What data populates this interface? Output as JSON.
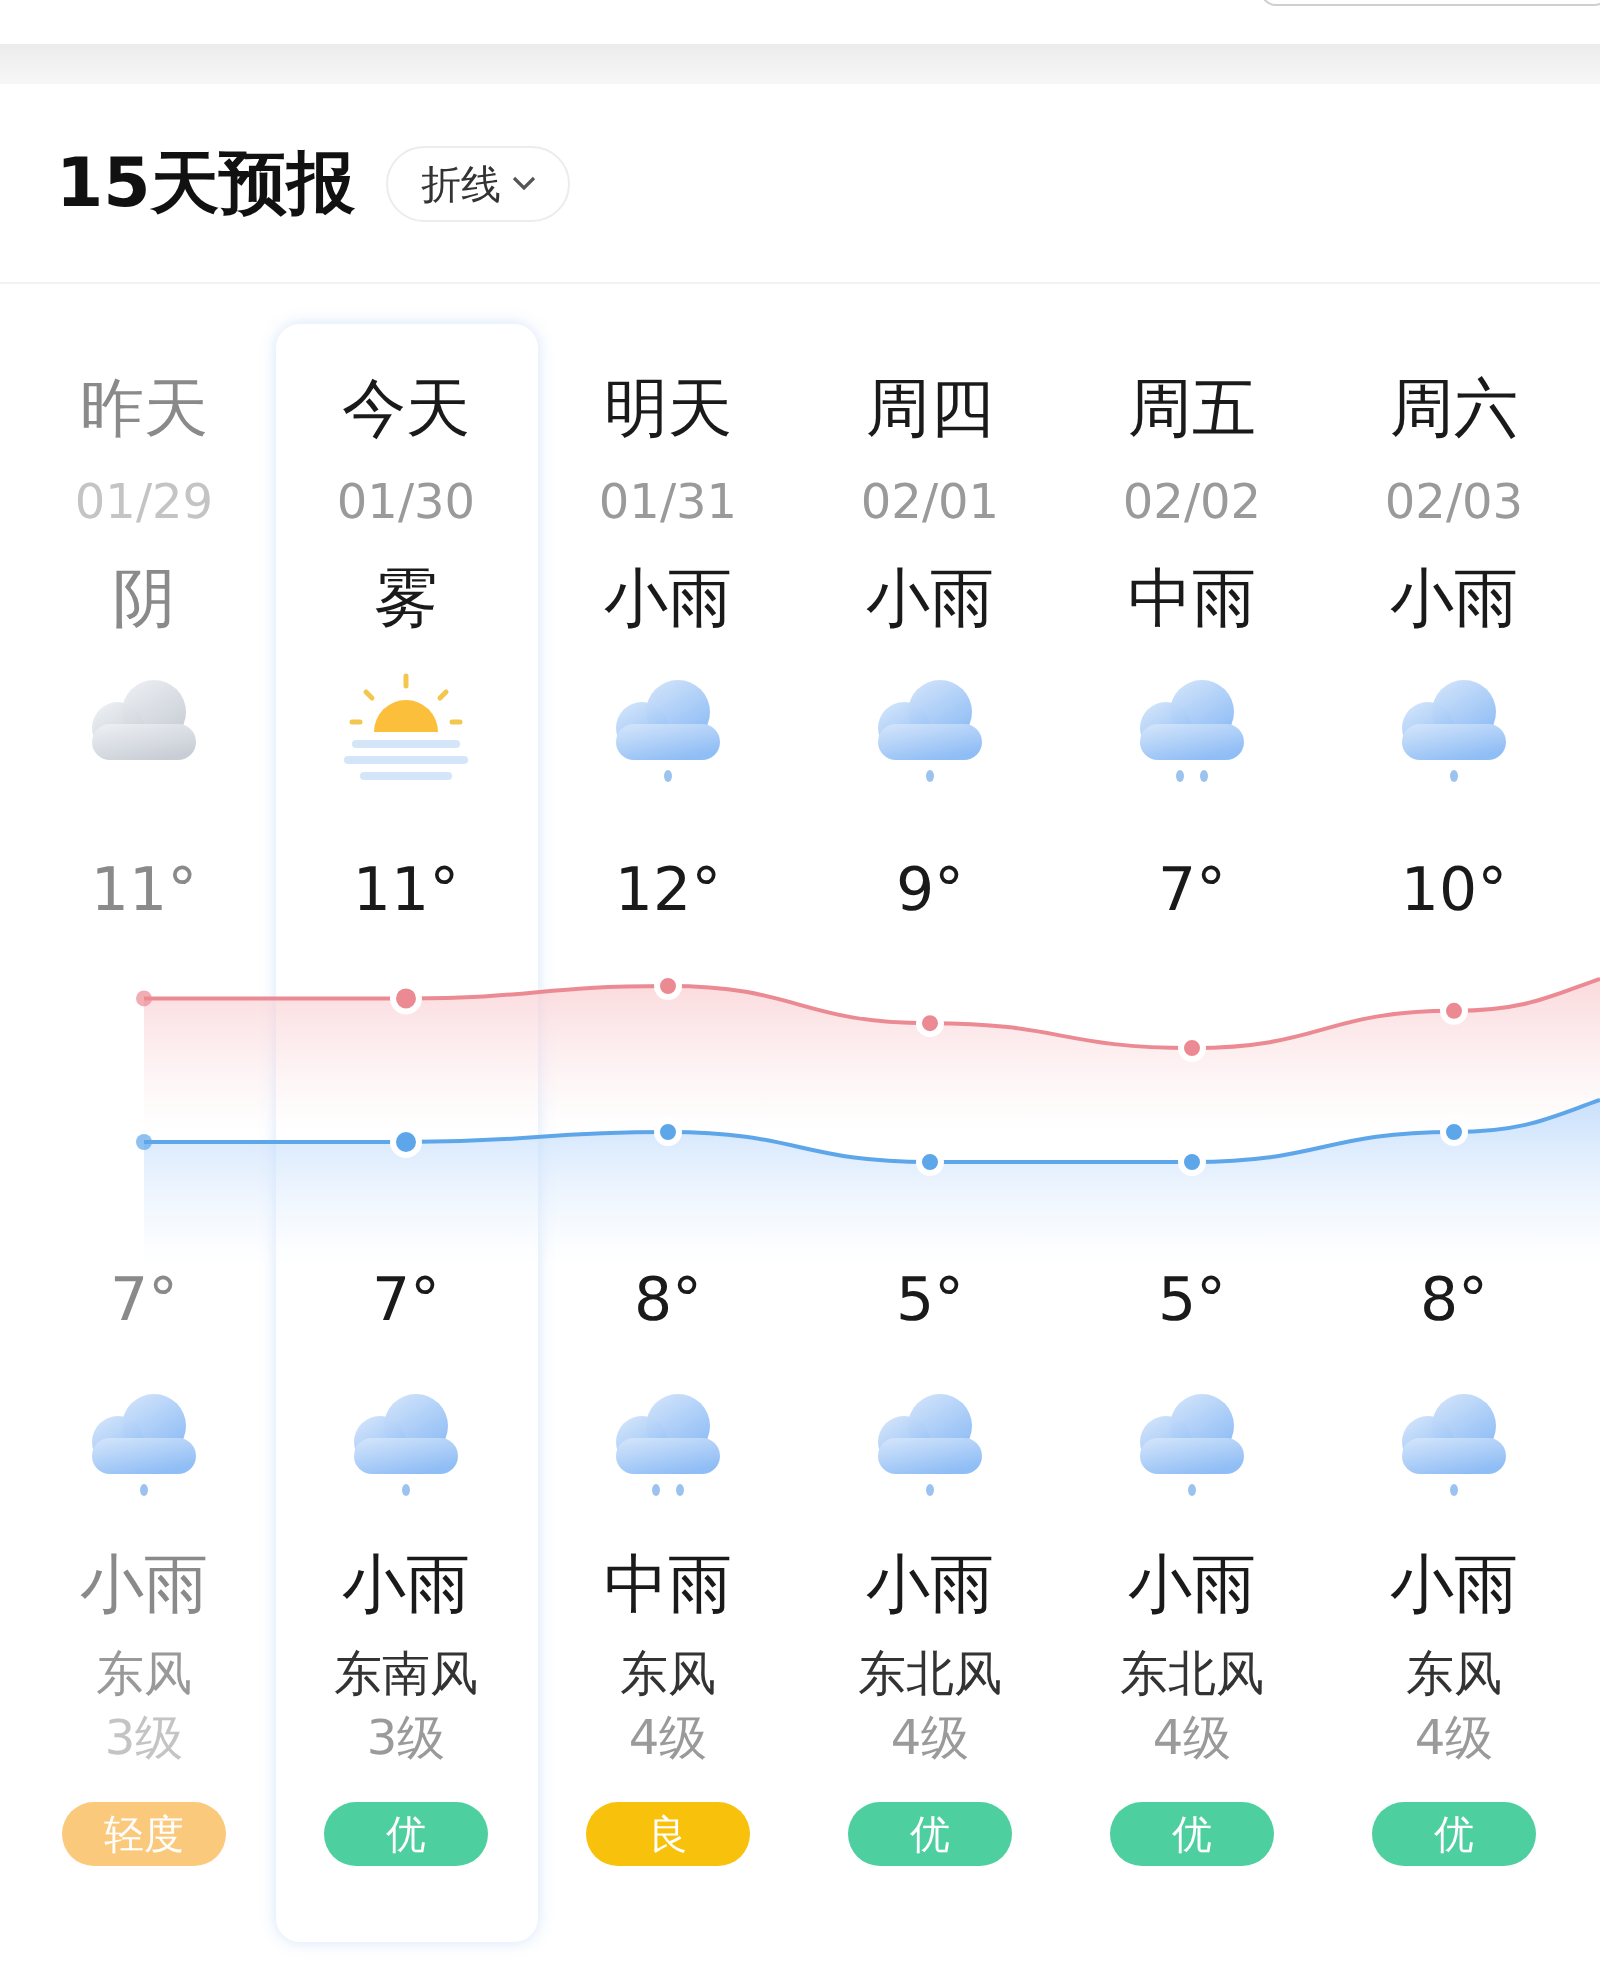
{
  "header": {
    "title": "15天预报",
    "view_switch": {
      "label": "折线"
    }
  },
  "days": [
    {
      "day": "昨天",
      "date": "01/29",
      "day_weather": "阴",
      "day_icon": {
        "kind": "cloudy"
      },
      "high": "11°",
      "low": "7°",
      "night_icon": {
        "kind": "light-rain"
      },
      "night_weather": "小雨",
      "wind": "东风",
      "wind_level": "3级",
      "aqi": {
        "label": "轻度",
        "color": "#fbc97c"
      },
      "past": true,
      "selected": false
    },
    {
      "day": "今天",
      "date": "01/30",
      "day_weather": "雾",
      "day_icon": {
        "kind": "fog"
      },
      "high": "11°",
      "low": "7°",
      "night_icon": {
        "kind": "light-rain"
      },
      "night_weather": "小雨",
      "wind": "东南风",
      "wind_level": "3级",
      "aqi": {
        "label": "优",
        "color": "#4ecf9f"
      },
      "past": false,
      "selected": true
    },
    {
      "day": "明天",
      "date": "01/31",
      "day_weather": "小雨",
      "day_icon": {
        "kind": "light-rain"
      },
      "high": "12°",
      "low": "8°",
      "night_icon": {
        "kind": "moderate-rain"
      },
      "night_weather": "中雨",
      "wind": "东风",
      "wind_level": "4级",
      "aqi": {
        "label": "良",
        "color": "#f8c20c"
      },
      "past": false,
      "selected": false
    },
    {
      "day": "周四",
      "date": "02/01",
      "day_weather": "小雨",
      "day_icon": {
        "kind": "light-rain"
      },
      "high": "9°",
      "low": "5°",
      "night_icon": {
        "kind": "light-rain"
      },
      "night_weather": "小雨",
      "wind": "东北风",
      "wind_level": "4级",
      "aqi": {
        "label": "优",
        "color": "#4ecf9f"
      },
      "past": false,
      "selected": false
    },
    {
      "day": "周五",
      "date": "02/02",
      "day_weather": "中雨",
      "day_icon": {
        "kind": "moderate-rain"
      },
      "high": "7°",
      "low": "5°",
      "night_icon": {
        "kind": "light-rain"
      },
      "night_weather": "小雨",
      "wind": "东北风",
      "wind_level": "4级",
      "aqi": {
        "label": "优",
        "color": "#4ecf9f"
      },
      "past": false,
      "selected": false
    },
    {
      "day": "周六",
      "date": "02/03",
      "day_weather": "小雨",
      "day_icon": {
        "kind": "light-rain"
      },
      "high": "10°",
      "low": "8°",
      "night_icon": {
        "kind": "light-rain"
      },
      "night_weather": "小雨",
      "wind": "东风",
      "wind_level": "4级",
      "aqi": {
        "label": "优",
        "color": "#4ecf9f"
      },
      "past": false,
      "selected": false
    }
  ]
}
